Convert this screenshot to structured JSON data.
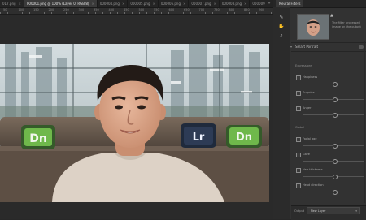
{
  "tabs": [
    {
      "label": "017.png",
      "active": false
    },
    {
      "label": "000001.png @ 100% (Layer 0, RGB/8)",
      "active": true
    },
    {
      "label": "000004.png",
      "active": false
    },
    {
      "label": "000005.png",
      "active": false
    },
    {
      "label": "000006.png",
      "active": false
    },
    {
      "label": "000007.png",
      "active": false
    },
    {
      "label": "000008.png",
      "active": false
    },
    {
      "label": "000009.png",
      "active": false
    },
    {
      "label": "000012.pn",
      "active": false
    }
  ],
  "tabbar_overflow_icon": "double-chevron-right-icon",
  "ruler": {
    "labels": [
      "50",
      "100",
      "150",
      "200",
      "250",
      "300",
      "350",
      "400",
      "450",
      "500",
      "550",
      "600",
      "650",
      "700",
      "750",
      "800",
      "850",
      "900"
    ]
  },
  "photo": {
    "pillow_left_text": "Dn",
    "pillow_mid_text": "Lr",
    "pillow_right_text": "Dn"
  },
  "panel": {
    "title": "Neural Filters",
    "thumbnail_arrow_icon": "triangle-up-icon",
    "thumbnail_note": "The filter processed image on the output",
    "section_title": "Smart Portrait",
    "section_chevron": "chevron-down-icon",
    "groups": [
      {
        "label": "Expressions",
        "items": [
          {
            "label": "Happiness",
            "value": 0.52
          },
          {
            "label": "Surprise",
            "value": 0.52
          },
          {
            "label": "Anger",
            "value": 0.52
          }
        ]
      },
      {
        "label": "Global",
        "items": [
          {
            "label": "Facial age",
            "value": 0.52
          },
          {
            "label": "Gaze",
            "value": 0.52
          },
          {
            "label": "Hair thickness",
            "value": 0.52
          },
          {
            "label": "Head direction",
            "value": 0.52
          }
        ]
      }
    ],
    "output_label": "Output",
    "output_value": "New Layer",
    "output_chevron": "chevron-down-icon"
  },
  "strip_icons": [
    "brush-icon",
    "hand-icon",
    "zoom-icon"
  ]
}
